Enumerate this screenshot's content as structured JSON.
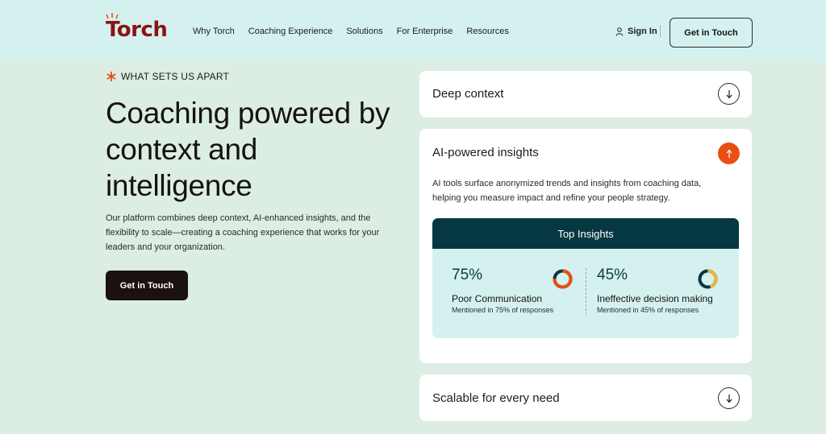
{
  "header": {
    "logo": "Torch",
    "nav": [
      "Why Torch",
      "Coaching Experience",
      "Solutions",
      "For Enterprise",
      "Resources"
    ],
    "sign_in": "Sign In",
    "cta": "Get in Touch"
  },
  "hero": {
    "eyebrow": "WHAT SETS US APART",
    "title": "Coaching powered by context and intelligence",
    "description": "Our platform combines deep context, AI-enhanced insights, and the flexibility to scale—creating a coaching experience that works for your leaders and your organization.",
    "cta": "Get in Touch"
  },
  "accordion": [
    {
      "title": "Deep context",
      "expanded": false
    },
    {
      "title": "AI-powered insights",
      "expanded": true,
      "description": "AI tools surface anonymized trends and insights from coaching data, helping you measure impact and refine your people strategy.",
      "insights": {
        "heading": "Top Insights",
        "stats": [
          {
            "value": "75%",
            "fraction": 0.75,
            "label": "Poor Communication",
            "sub": "Mentioned in 75% of responses",
            "color": "#ea4e14"
          },
          {
            "value": "45%",
            "fraction": 0.45,
            "label": "Ineffective decision making",
            "sub": "Mentioned in 45% of responses",
            "color": "#e8b53a"
          }
        ]
      }
    },
    {
      "title": "Scalable for every need",
      "expanded": false
    }
  ],
  "colors": {
    "brand": "#8a1313",
    "accent": "#ea4e14",
    "header_bg": "#d4f1ef",
    "page_bg": "#dcede3",
    "insights_head": "#053843"
  }
}
